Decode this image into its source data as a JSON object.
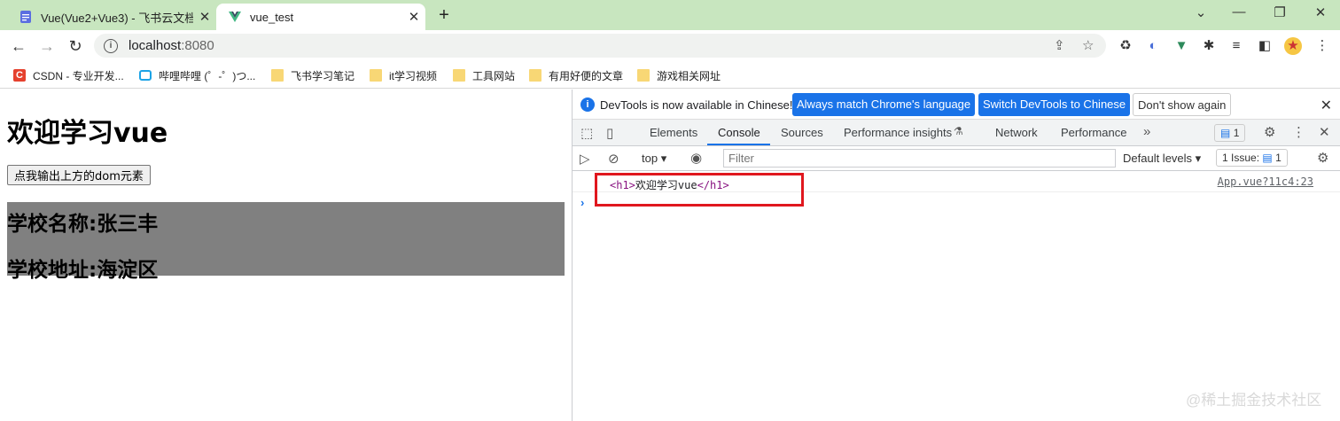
{
  "tabs": [
    {
      "label": "Vue(Vue2+Vue3) - 飞书云文档",
      "icon": "document-icon"
    },
    {
      "label": "vue_test",
      "icon": "vue-logo-icon"
    }
  ],
  "address": {
    "host": "localhost",
    "port": ":8080"
  },
  "bookmarks": [
    {
      "label": "CSDN - 专业开发...",
      "icon": "csdn-icon"
    },
    {
      "label": "哔哩哔哩 (゜-゜)つ...",
      "icon": "bilibili-icon"
    },
    {
      "label": "飞书学习笔记",
      "icon": "folder-icon"
    },
    {
      "label": "it学习视频",
      "icon": "folder-icon"
    },
    {
      "label": "工具网站",
      "icon": "folder-icon"
    },
    {
      "label": "有用好便的文章",
      "icon": "folder-icon"
    },
    {
      "label": "游戏相关网址",
      "icon": "folder-icon"
    }
  ],
  "page": {
    "heading": "欢迎学习vue",
    "button": "点我输出上方的dom元素",
    "school_name": "学校名称:张三丰",
    "school_address": "学校地址:海淀区"
  },
  "devtools": {
    "infobar": {
      "message": "DevTools is now available in Chinese!",
      "btn_match": "Always match Chrome's language",
      "btn_switch": "Switch DevTools to Chinese",
      "btn_dismiss": "Don't show again"
    },
    "tabs": [
      "Elements",
      "Console",
      "Sources",
      "Performance insights",
      "Network",
      "Performance"
    ],
    "messages_count": "1",
    "context": "top",
    "filter_placeholder": "Filter",
    "levels": "Default levels",
    "issues_label": "1 Issue:",
    "issues_count": "1",
    "console": {
      "open_tag": "<h1>",
      "text": "欢迎学习vue",
      "close_tag": "</h1>",
      "source": "App.vue?11c4:23"
    }
  },
  "watermark": "@稀土掘金技术社区"
}
